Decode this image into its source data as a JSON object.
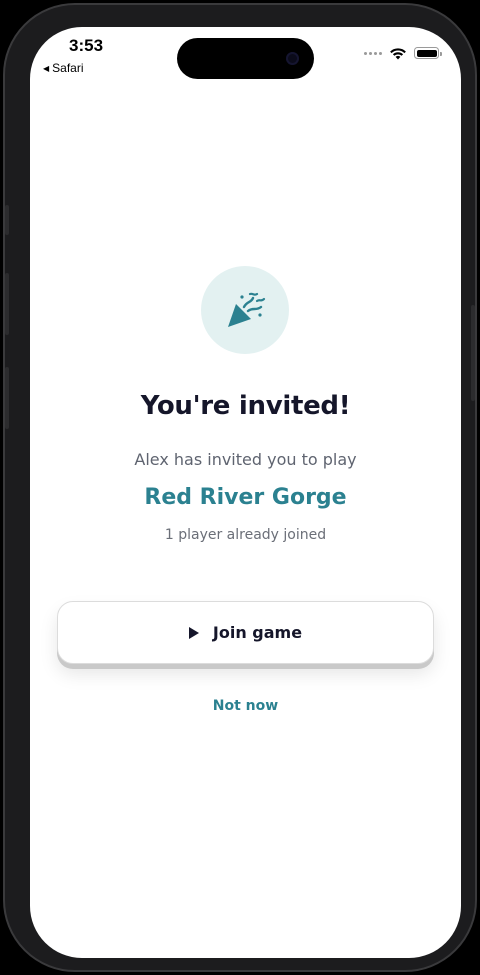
{
  "status_bar": {
    "time": "3:53",
    "back_app": "Safari",
    "icons": [
      "cellular-icon",
      "wifi-icon",
      "battery-icon"
    ]
  },
  "invite": {
    "icon": "party-popper-icon",
    "title": "You're invited!",
    "subtitle": "Alex has invited you to play",
    "game_name": "Red River Gorge",
    "joined_text": "1 player already joined"
  },
  "actions": {
    "join_label": "Join game",
    "join_icon": "play-icon",
    "dismiss_label": "Not now"
  },
  "colors": {
    "accent": "#2b8190",
    "badge_bg": "#e3f1f1",
    "title": "#15162a"
  }
}
